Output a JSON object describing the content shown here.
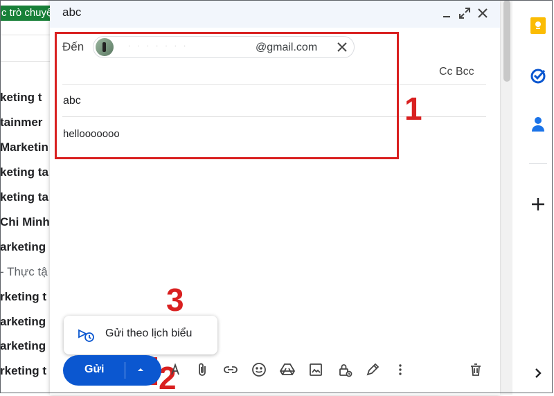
{
  "background_list": {
    "tag": "c trò chuyệ",
    "rows": [
      "keting t",
      "tainmer",
      "Marketin",
      "keting ta",
      "keting ta",
      "Chi Minh",
      "arketing",
      "- Thực tậ",
      "rketing t",
      "arketing",
      "arketing",
      "rketing t"
    ]
  },
  "compose": {
    "title": "abc",
    "to_label": "Đến",
    "recipient_email": "@gmail.com",
    "cc_bcc": "Cc Bcc",
    "subject": "abc",
    "body": "hellooooooo"
  },
  "schedule_menu": {
    "label": "Gửi theo lịch biểu"
  },
  "toolbar": {
    "send_label": "Gửi"
  },
  "annotations": {
    "one": "1",
    "two": "2",
    "three": "3"
  },
  "colors": {
    "accent": "#0b57d0",
    "annotation_red": "#d92020",
    "chat_tag_green": "#188038"
  },
  "icons": [
    "minimize-icon",
    "expand-icon",
    "close-icon",
    "schedule-send-icon",
    "text-format-icon",
    "attach-icon",
    "link-icon",
    "emoji-icon",
    "drive-icon",
    "image-icon",
    "confidential-lock-icon",
    "signature-pen-icon",
    "more-options-icon",
    "trash-icon",
    "keep-icon",
    "tasks-icon",
    "contacts-icon",
    "add-icon",
    "chevron-right-icon"
  ]
}
